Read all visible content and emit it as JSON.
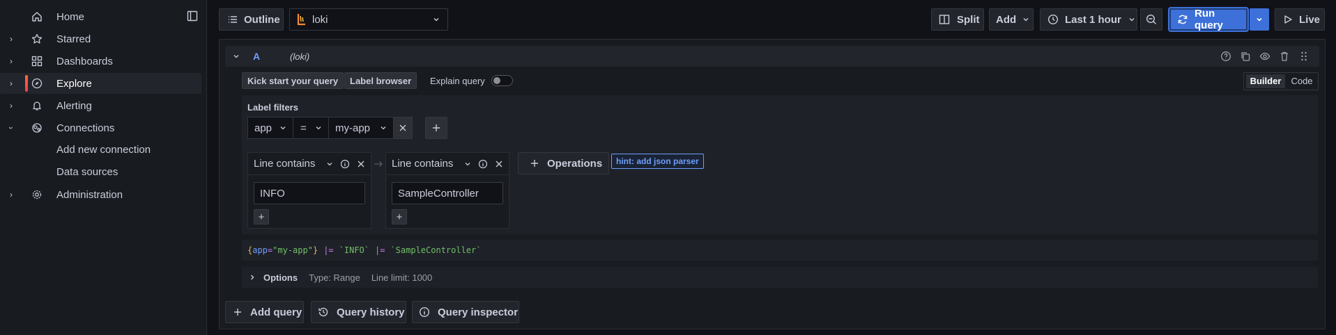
{
  "sidebar": {
    "items": [
      {
        "label": "Home",
        "icon": "home-icon",
        "chevron": false
      },
      {
        "label": "Starred",
        "icon": "star-icon",
        "chevron": true
      },
      {
        "label": "Dashboards",
        "icon": "apps-icon",
        "chevron": true
      },
      {
        "label": "Explore",
        "icon": "compass-icon",
        "chevron": true,
        "active": true
      },
      {
        "label": "Alerting",
        "icon": "bell-icon",
        "chevron": true
      },
      {
        "label": "Connections",
        "icon": "connections-icon",
        "chevron": true,
        "expanded": true
      },
      {
        "label": "Administration",
        "icon": "cog-icon",
        "chevron": true
      }
    ],
    "sub_items": [
      "Add new connection",
      "Data sources"
    ]
  },
  "toolbar": {
    "outline_label": "Outline",
    "datasource": "loki",
    "split_label": "Split",
    "add_label": "Add",
    "time_range": "Last 1 hour",
    "run_query_label": "Run query",
    "live_label": "Live"
  },
  "query": {
    "ref_id": "A",
    "datasource_tag": "(loki)",
    "kick_start_label": "Kick start your query",
    "label_browser_label": "Label browser",
    "explain_label": "Explain query",
    "mode_builder": "Builder",
    "mode_code": "Code",
    "label_filters_title": "Label filters",
    "filter": {
      "label": "app",
      "operator": "=",
      "value": "my-app"
    },
    "operations": [
      {
        "name": "Line contains",
        "value": "INFO"
      },
      {
        "name": "Line contains",
        "value": "SampleController"
      }
    ],
    "operations_button": "Operations",
    "hint": "hint: add json parser",
    "preview": {
      "open": "{",
      "key": "app",
      "eq": "=",
      "val": "\"my-app\"",
      "close": "}",
      "pipe1": "|=",
      "str1": "`INFO`",
      "pipe2": "|=",
      "str2": "`SampleController`"
    },
    "options_label": "Options",
    "options_type": "Type: Range",
    "options_limit": "Line limit: 1000"
  },
  "bottom": {
    "add_query": "Add query",
    "query_history": "Query history",
    "query_inspector": "Query inspector"
  },
  "colors": {
    "accent_blue": "#3d71d9",
    "hint_blue": "#6e9fff",
    "orange": "#ff8833"
  }
}
